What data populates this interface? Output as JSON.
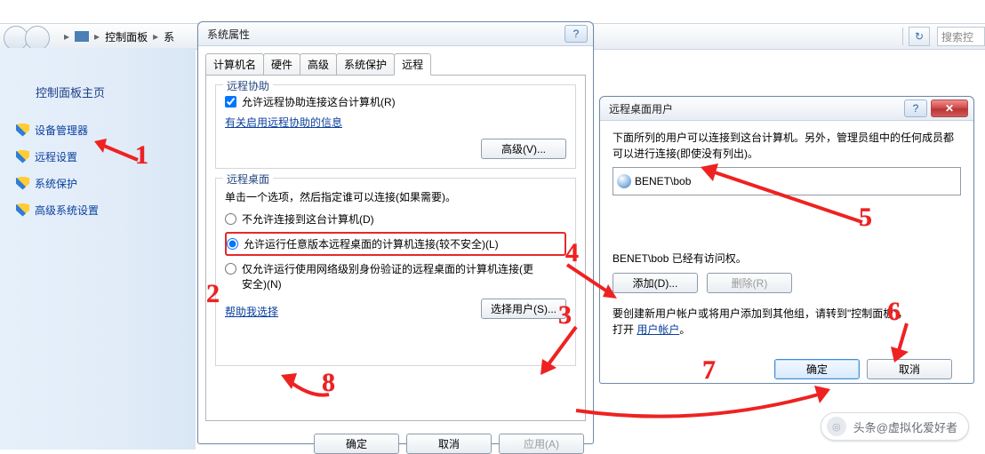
{
  "explorer": {
    "path_icon": "control-panel-icon",
    "path_label": "控制面板",
    "path_tail": "系",
    "refresh_glyph": "↻",
    "search_placeholder": "搜索控"
  },
  "sidebar": {
    "title": "控制面板主页",
    "items": [
      {
        "label": "设备管理器"
      },
      {
        "label": "远程设置"
      },
      {
        "label": "系统保护"
      },
      {
        "label": "高级系统设置"
      }
    ]
  },
  "sysprops": {
    "title": "系统属性",
    "help_glyph": "?",
    "tabs": [
      "计算机名",
      "硬件",
      "高级",
      "系统保护",
      "远程"
    ],
    "active_tab": 4,
    "remote_assist": {
      "group": "远程协助",
      "checkbox": "允许远程协助连接这台计算机(R)",
      "link": "有关启用远程协助的信息",
      "advanced_btn": "高级(V)..."
    },
    "remote_desktop": {
      "group": "远程桌面",
      "hint": "单击一个选项，然后指定谁可以连接(如果需要)。",
      "opt_none": "不允许连接到这台计算机(D)",
      "opt_any": "允许运行任意版本远程桌面的计算机连接(较不安全)(L)",
      "opt_nla": "仅允许运行使用网络级别身份验证的远程桌面的计算机连接(更安全)(N)",
      "help_link": "帮助我选择",
      "select_users_btn": "选择用户(S)..."
    },
    "buttons": {
      "ok": "确定",
      "cancel": "取消",
      "apply": "应用(A)"
    }
  },
  "remusers": {
    "title": "远程桌面用户",
    "help_glyph": "?",
    "close_glyph": "✕",
    "intro": "下面所列的用户可以连接到这台计算机。另外，管理员组中的任何成员都可以进行连接(即使没有列出)。",
    "user_entry": "BENET\\bob",
    "already_note": "BENET\\bob 已经有访问权。",
    "add_btn": "添加(D)...",
    "remove_btn": "删除(R)",
    "create_hint_1": "要创建新用户帐户或将用户添加到其他组，请转到\"控制面板\"，",
    "create_hint_2": "打开 ",
    "user_accounts_link": "用户帐户",
    "ok": "确定",
    "cancel": "取消"
  },
  "annotations": {
    "n1": "1",
    "n2": "2",
    "n3": "3",
    "n4": "4",
    "n5": "5",
    "n6": "6",
    "n7": "7",
    "n8": "8"
  },
  "attribution": {
    "prefix": "头条 ",
    "handle": "@虚拟化爱好者"
  }
}
